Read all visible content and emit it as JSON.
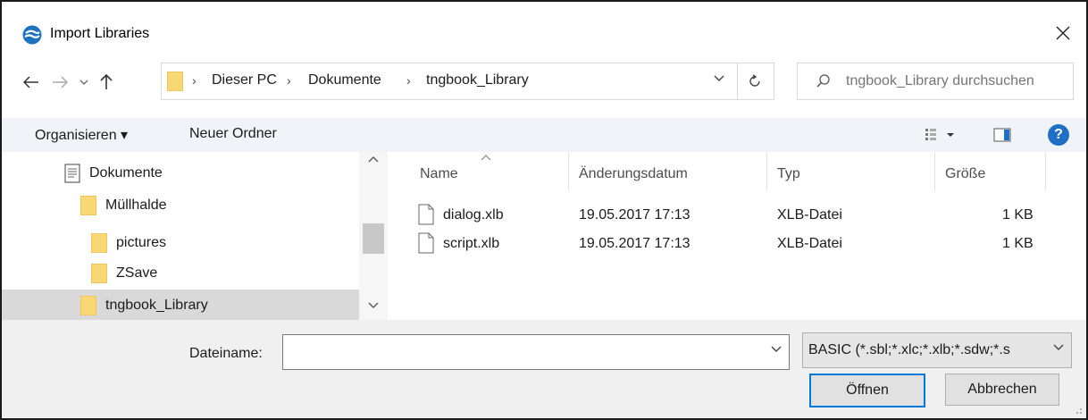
{
  "window": {
    "title": "Import Libraries"
  },
  "address": {
    "crumbs": [
      "Dieser PC",
      "Dokumente",
      "tngbook_Library"
    ]
  },
  "search": {
    "placeholder": "tngbook_Library durchsuchen",
    "value": ""
  },
  "toolbar": {
    "organize_label": "Organisieren ▾",
    "new_folder_label": "Neuer Ordner",
    "help_label": "?"
  },
  "tree": {
    "items": [
      {
        "label": "Dokumente",
        "icon": "documents-icon",
        "selected": false
      },
      {
        "label": "Müllhalde",
        "icon": "folder-icon",
        "selected": false
      },
      {
        "label": "pictures",
        "icon": "folder-icon",
        "selected": false
      },
      {
        "label": "ZSave",
        "icon": "folder-icon",
        "selected": false
      },
      {
        "label": "tngbook_Library",
        "icon": "folder-icon",
        "selected": true
      }
    ]
  },
  "filelist": {
    "columns": [
      "Name",
      "Änderungsdatum",
      "Typ",
      "Größe"
    ],
    "rows": [
      {
        "name": "dialog.xlb",
        "date": "19.05.2017 17:13",
        "type": "XLB-Datei",
        "size": "1 KB"
      },
      {
        "name": "script.xlb",
        "date": "19.05.2017 17:13",
        "type": "XLB-Datei",
        "size": "1 KB"
      }
    ]
  },
  "bottom": {
    "filename_label": "Dateiname:",
    "filename_value": "",
    "filter_value": "BASIC (*.sbl;*.xlc;*.xlb;*.sdw;*.s",
    "open_label": "Öffnen",
    "cancel_label": "Abbrechen"
  },
  "colors": {
    "accent": "#0078d7",
    "help": "#1f6fc5",
    "folder": "#f8d775",
    "selection": "#d9d9d9"
  }
}
